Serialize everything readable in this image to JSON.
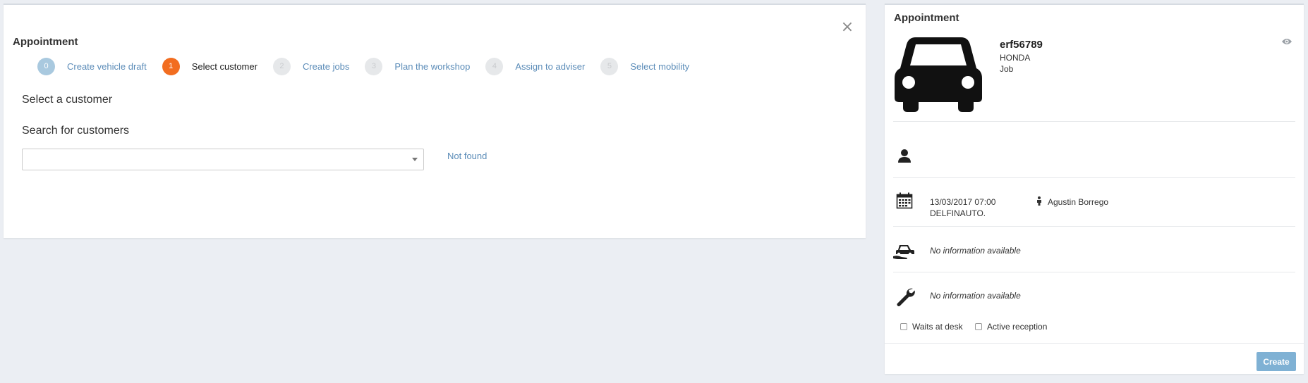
{
  "wizard": {
    "title": "Appointment",
    "close_glyph": "×",
    "steps": [
      {
        "number": "0",
        "label": "Create vehicle draft",
        "state": "done"
      },
      {
        "number": "1",
        "label": "Select customer",
        "state": "active"
      },
      {
        "number": "2",
        "label": "Create jobs",
        "state": "pending"
      },
      {
        "number": "3",
        "label": "Plan the workshop",
        "state": "pending"
      },
      {
        "number": "4",
        "label": "Assign to adviser",
        "state": "pending"
      },
      {
        "number": "5",
        "label": "Select mobility",
        "state": "pending"
      }
    ],
    "section_title": "Select a customer",
    "search_title": "Search for customers",
    "search_value": "",
    "not_found_link": "Not found"
  },
  "summary": {
    "title": "Appointment",
    "vehicle": {
      "plate": "erf56789",
      "brand": "HONDA",
      "type": "Job"
    },
    "appointment": {
      "datetime": "13/03/2017 07:00",
      "place": "DELFINAUTO.",
      "adviser": "Agustin Borrego"
    },
    "mobility_info": "No information available",
    "jobs_info": "No information available",
    "waits_at_desk_label": "Waits at desk",
    "active_reception_label": "Active reception",
    "create_label": "Create"
  },
  "colors": {
    "active_step": "#f26d20",
    "done_step": "#a9c9df",
    "link": "#5b8cb8",
    "create_button": "#7fb1d4",
    "background": "#ebeef3"
  },
  "icons": {
    "close": "close-icon",
    "car": "car-icon",
    "eye": "eye-icon",
    "user": "user-icon",
    "calendar": "calendar-icon",
    "person": "person-icon",
    "mobility": "car-service-icon",
    "wrench": "wrench-icon",
    "caret": "caret-down-icon"
  }
}
